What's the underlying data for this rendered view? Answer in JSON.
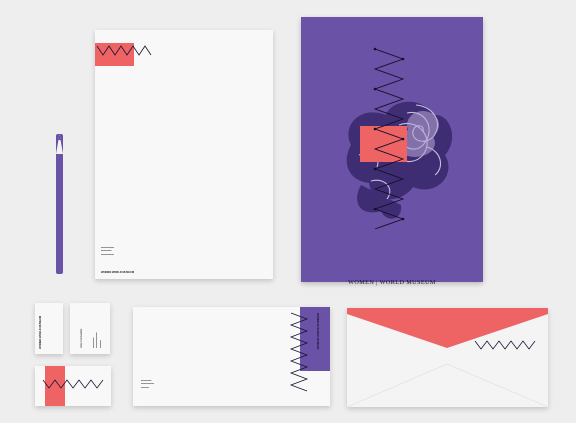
{
  "colors": {
    "background": "#eeeeee",
    "paper": "#f8f8f8",
    "purple": "#6a52a6",
    "coral": "#ee6464",
    "ink": "#1a1233"
  },
  "brand": {
    "name": "WOMEN IN WORLD MUSEUM",
    "poster_title": "WOMEN | WORLD MUSEUM",
    "monogram": "VVVVVV"
  },
  "letterhead": {
    "footer_label": "WOMEN WORLD MUSEUM"
  },
  "business_card_back": {
    "label": "WOMEN WORLD MUSEUM"
  },
  "business_card_front": {
    "name": "Jane Fornwalder"
  },
  "dl_sheet": {
    "strip_label": "WOMEN IN WORLD MUSEUM"
  },
  "icons": {
    "flower": "rose-flower-icon",
    "zigzag": "zigzag-monogram-icon"
  }
}
